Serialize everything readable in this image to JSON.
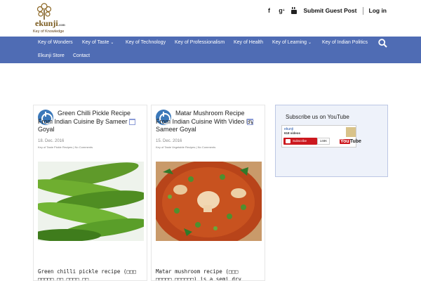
{
  "header": {
    "logo": {
      "brand": "ekunji",
      "dotcom": ".com",
      "tagline": "Key of Knowledge"
    },
    "social_icons": [
      "facebook-icon",
      "google-plus-icon",
      "youtube-icon"
    ],
    "submit_label": "Submit Guest Post",
    "login_label": "Log in"
  },
  "nav": {
    "items": [
      {
        "label": "Key of Wonders",
        "has_caret": false
      },
      {
        "label": "Key of Taste",
        "has_caret": true
      },
      {
        "label": "Key of Technology",
        "has_caret": false
      },
      {
        "label": "Key of Professionalism",
        "has_caret": false
      },
      {
        "label": "Key of Health",
        "has_caret": false
      },
      {
        "label": "Key of Learning",
        "has_caret": true
      },
      {
        "label": "Key of Indian Politics",
        "has_caret": false
      },
      {
        "label": "Ekunji Store",
        "has_caret": false
      },
      {
        "label": "Contact",
        "has_caret": false
      }
    ],
    "caret": "⌄"
  },
  "posts": [
    {
      "title": "Green Chilli Pickle Recipe From Indian Cuisine By Sameer Goyal",
      "date": "18. Dec. 2016",
      "meta": "Key of Taste  Pickle Recipes | No Comments",
      "excerpt": "Green chilli pickle recipe (□□□\n□□□□□ □□ □□□□ □□"
    },
    {
      "title": "Matar Mushroom Recipe From Indian Cuisine With Video By Sameer Goyal",
      "date": "15. Dec. 2016",
      "meta": "Key of Taste  Vegetable Recipes | No Comments",
      "excerpt": "Matar mushroom recipe (□□□\n□□□□□ □□□□□□) is a semi dry"
    }
  ],
  "sidebar": {
    "widget_title": "Subscribe us on YouTube",
    "channel_name": "ekunji",
    "video_count": "618 videos",
    "subscribe_label": "Subscribe",
    "subscriber_count": "148K",
    "yt_logo": {
      "you": "You",
      "tube": "Tube"
    }
  },
  "colors": {
    "nav_bg": "#4f6cb4",
    "accent": "#3b78b9",
    "youtube_red": "#cc181e"
  }
}
